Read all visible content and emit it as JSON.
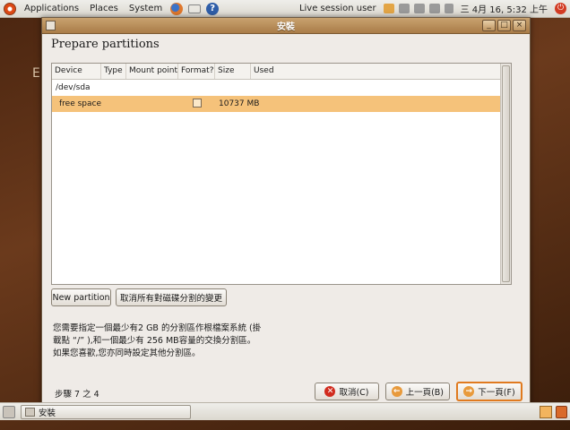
{
  "top_panel": {
    "menus": [
      "Applications",
      "Places",
      "System"
    ],
    "user": "Live session user",
    "clock": "三 4月 16, 5:32 上午"
  },
  "background_text": "E",
  "window": {
    "title": "安裝",
    "heading": "Prepare partitions",
    "table": {
      "columns": [
        "Device",
        "Type",
        "Mount point",
        "Format?",
        "Size",
        "Used"
      ],
      "rows": [
        {
          "device": "/dev/sda",
          "type": "",
          "mount": "",
          "format": false,
          "size": "",
          "used": ""
        },
        {
          "device": "free space",
          "type": "",
          "mount": "",
          "format": false,
          "size": "10737 MB",
          "used": ""
        }
      ]
    },
    "buttons": {
      "new_partition": "New partition",
      "undo_changes": "取消所有對磁碟分割的變更",
      "cancel": "取消(C)",
      "back": "上一頁(B)",
      "forward": "下一頁(F)"
    },
    "info_lines": [
      "您需要指定一個最少有2 GB 的分割區作根檔案系統 (掛",
      "載點 “/” ),和一個最少有 256 MB容量的交換分割區。",
      "如果您喜歡,您亦同時設定其他分割區。"
    ],
    "step": "步驟 7 之 4"
  },
  "bottom_panel": {
    "task_label": "安裝"
  }
}
